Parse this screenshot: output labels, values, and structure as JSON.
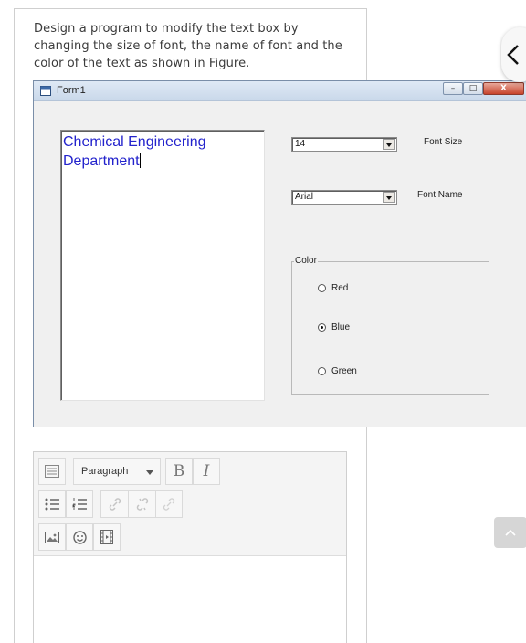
{
  "question": {
    "text": "Design a program to modify the text box by changing the size of font, the name of font and the color of the text as shown in Figure."
  },
  "form_window": {
    "title": "Form1",
    "buttons": {
      "minimize": "–",
      "maximize": "□",
      "close": "X"
    },
    "textbox": {
      "value": "Chemical Engineering\nDepartment",
      "color": "#2222cc"
    },
    "font_size": {
      "selected": "14",
      "label": "Font Size"
    },
    "font_name": {
      "selected": "Arial",
      "label": "Font Name"
    },
    "color_group": {
      "title": "Color",
      "options": [
        {
          "label": "Red",
          "selected": false
        },
        {
          "label": "Blue",
          "selected": true
        },
        {
          "label": "Green",
          "selected": false
        }
      ]
    }
  },
  "editor": {
    "paragraph_label": "Paragraph",
    "bold_label": "B",
    "italic_label": "I",
    "icons": [
      "toolbar-toggle-icon",
      "bullet-list-icon",
      "numbered-list-icon",
      "link-icon",
      "unlink-icon",
      "anchor-icon",
      "image-icon",
      "emoji-icon",
      "media-icon"
    ]
  },
  "nav": {
    "back_icon": "chevron-left-icon",
    "scroll_top_icon": "chevron-up-icon"
  }
}
